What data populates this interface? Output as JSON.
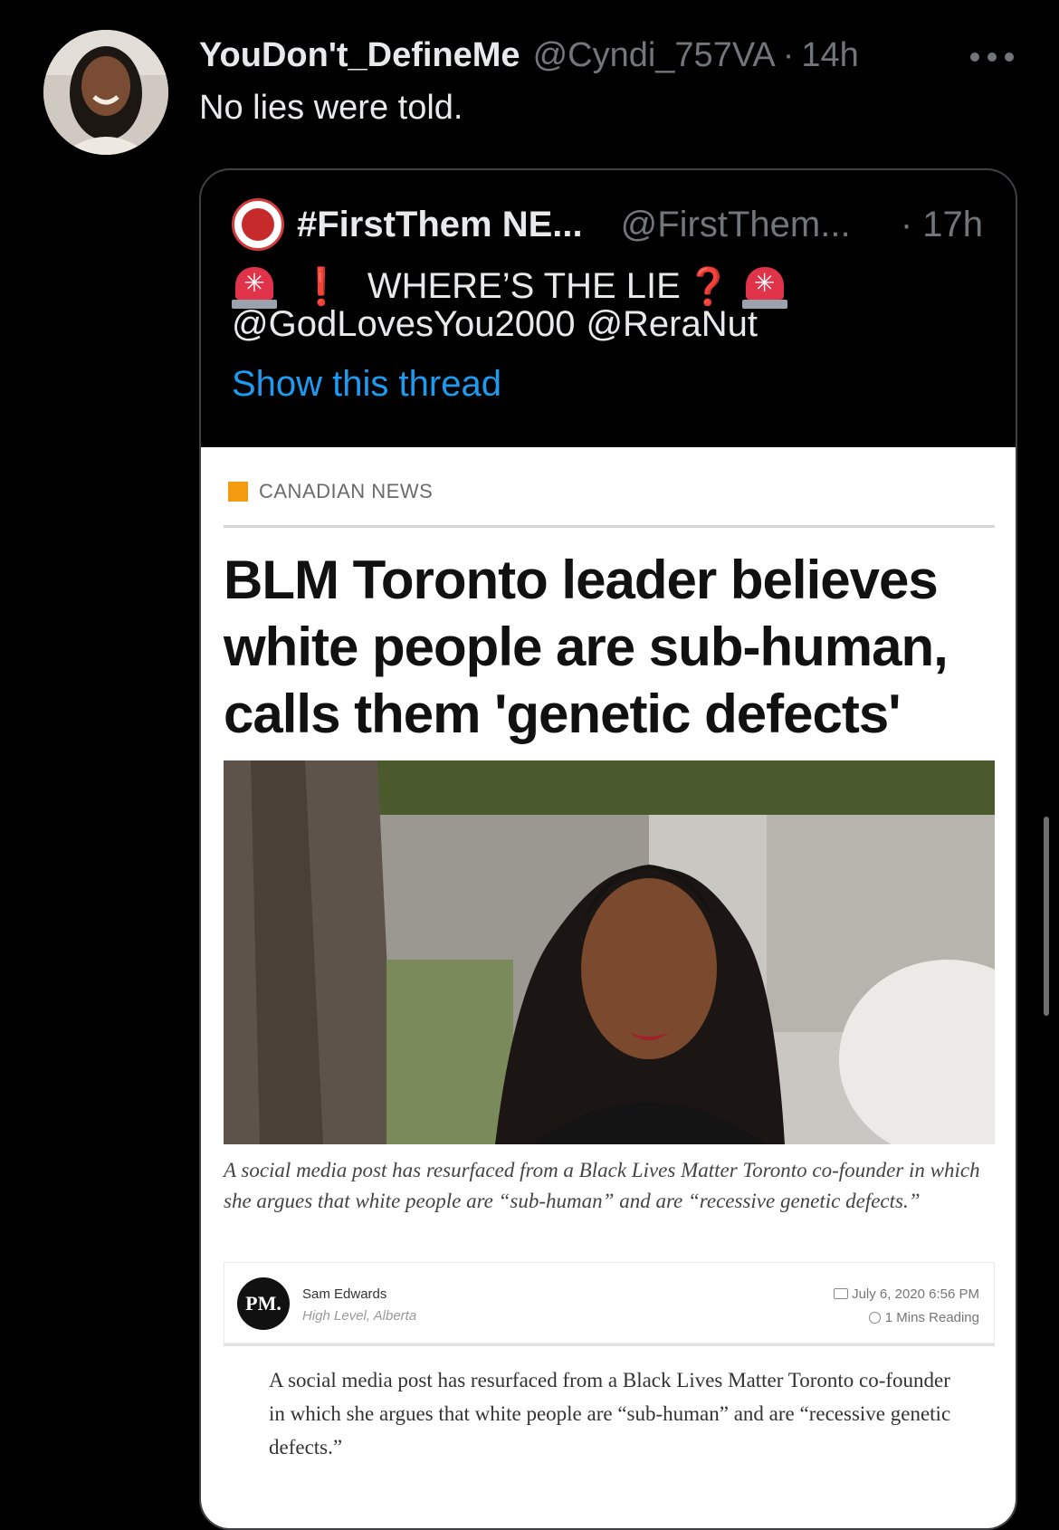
{
  "tweet": {
    "display_name": "YouDon't_DefineMe",
    "handle": "@Cyndi_757VA",
    "separator": "·",
    "time": "14h",
    "text": "No lies were told."
  },
  "quoted_tweet": {
    "display_name": "#FirstThem NE...",
    "handle": "@FirstThem...",
    "time": "· 17h",
    "line1_text": "WHERE’S THE LIE",
    "exclamation": "❗",
    "question": "❓",
    "mentions": [
      "@GodLovesYou2000",
      "@ReraNut"
    ],
    "show_thread": "Show this thread"
  },
  "article": {
    "category": "CANADIAN NEWS",
    "headline": "BLM Toronto leader believes white people are sub-human, calls them 'genetic defects'",
    "caption": "A social media post has resurfaced from a Black Lives Matter Toronto co-founder in which she argues that white people are “sub-human” and are “recessive genetic defects.”",
    "logo_text": "PM.",
    "author": "Sam Edwards",
    "location": "High Level, Alberta",
    "date": "July 6, 2020 6:56 PM",
    "reading_time": "1 Mins Reading",
    "body": "A social media post has resurfaced from a Black Lives Matter Toronto co-founder in which she argues that white people are “sub-human” and are “recessive genetic defects.”"
  },
  "colors": {
    "background": "#000000",
    "link": "#1d9bf0",
    "muted": "#71767b",
    "category_accent": "#f39c12"
  }
}
